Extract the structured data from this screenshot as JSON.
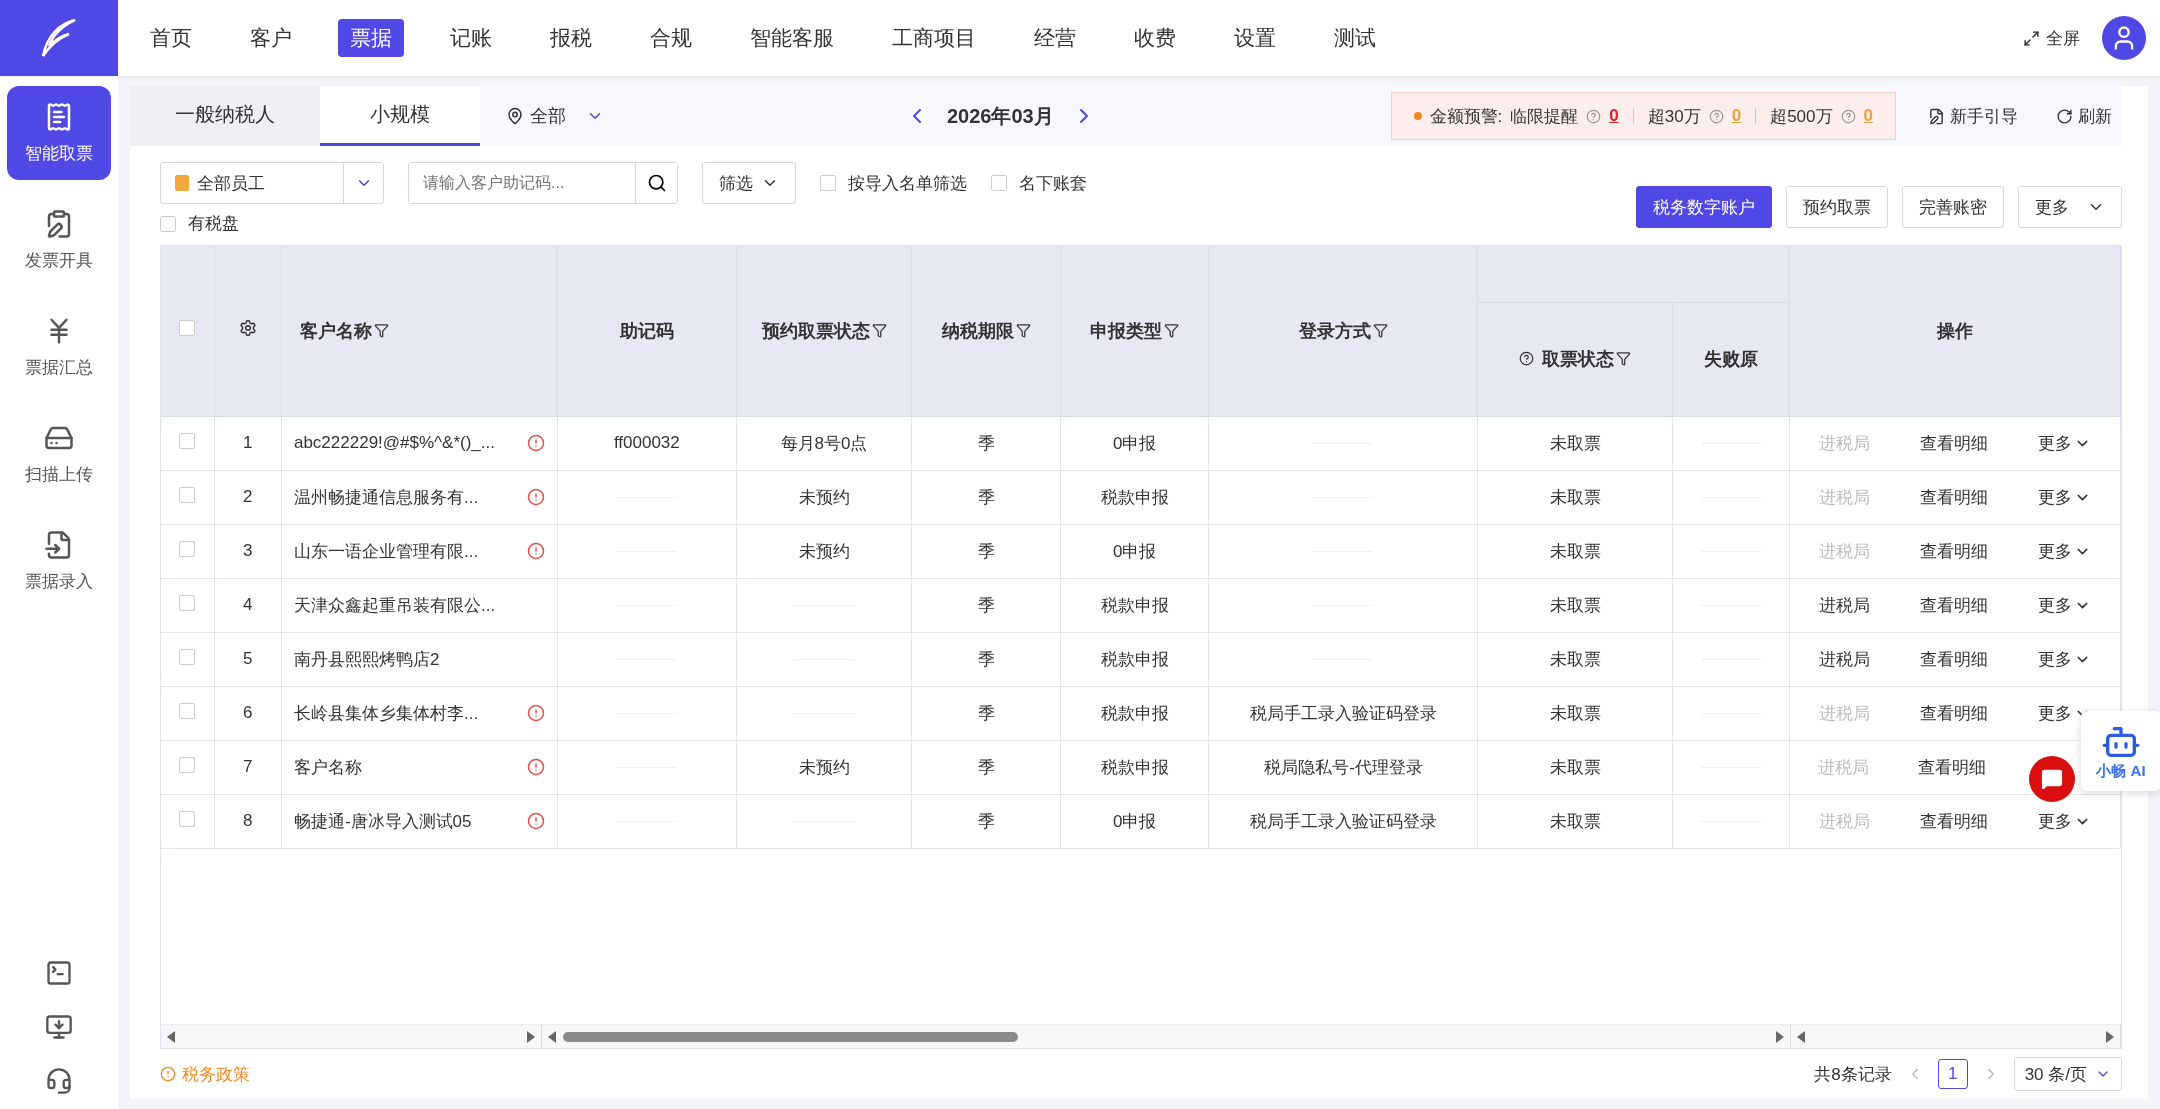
{
  "nav": {
    "items": [
      {
        "label": "首页",
        "selected": false
      },
      {
        "label": "客户",
        "selected": false
      },
      {
        "label": "票据",
        "selected": true
      },
      {
        "label": "记账",
        "selected": false
      },
      {
        "label": "报税",
        "selected": false
      },
      {
        "label": "合规",
        "selected": false
      },
      {
        "label": "智能客服",
        "selected": false
      },
      {
        "label": "工商项目",
        "selected": false
      },
      {
        "label": "经营",
        "selected": false
      },
      {
        "label": "收费",
        "selected": false
      },
      {
        "label": "设置",
        "selected": false
      },
      {
        "label": "测试",
        "selected": false
      }
    ],
    "fullscreen": "全屏"
  },
  "sidebar": {
    "items": [
      {
        "label": "智能取票",
        "selected": true
      },
      {
        "label": "发票开具",
        "selected": false
      },
      {
        "label": "票据汇总",
        "selected": false
      },
      {
        "label": "扫描上传",
        "selected": false
      },
      {
        "label": "票据录入",
        "selected": false
      }
    ]
  },
  "tabs": [
    {
      "label": "一般纳税人",
      "selected": false
    },
    {
      "label": "小规模",
      "selected": true
    }
  ],
  "location": "全部",
  "period": "2026年03月",
  "alert": {
    "title": "金额预警:",
    "items": [
      {
        "label": "临限提醒",
        "count": "0",
        "color": "#e02020"
      },
      {
        "label": "超30万",
        "count": "0",
        "color": "#e6a23c"
      },
      {
        "label": "超500万",
        "count": "0",
        "color": "#e6a23c"
      }
    ]
  },
  "header_actions": [
    "新手引导",
    "刷新"
  ],
  "toolbar": {
    "staff": "全部员工",
    "search": {
      "placeholder": "请输入客户助记码..."
    },
    "filter": "筛选",
    "checks": [
      {
        "label": "按导入名单筛选",
        "checked": false
      },
      {
        "label": "名下账套",
        "checked": false
      },
      {
        "label": "有税盘",
        "checked": false
      }
    ],
    "buttons": [
      {
        "label": "税务数字账户",
        "kind": "primary"
      },
      {
        "label": "预约取票",
        "kind": "plain"
      },
      {
        "label": "完善账密",
        "kind": "plain"
      },
      {
        "label": "更多",
        "kind": "dropdown"
      }
    ]
  },
  "table": {
    "select_all": {
      "checked": false
    },
    "columns": [
      {
        "label": "客户名称",
        "filter": true
      },
      {
        "label": "助记码",
        "filter": false
      },
      {
        "label": "预约取票状态",
        "filter": true
      },
      {
        "label": "纳税期限",
        "filter": true
      },
      {
        "label": "申报类型",
        "filter": true
      },
      {
        "label": "登录方式",
        "filter": true
      },
      {
        "label": "取票状态",
        "filter": true
      },
      {
        "label": "失败原",
        "filter": false
      },
      {
        "label": "操作",
        "filter": false
      }
    ],
    "rows": [
      {
        "checked": false,
        "index": "1",
        "name": "abc222229!@#$%^&*()_...",
        "warn": true,
        "code": "ff000032",
        "reserve": "每月8号0点",
        "period": "季",
        "type": "0申报",
        "login": null,
        "status": "未取票",
        "enter": {
          "label": "进税局",
          "disabled": true
        },
        "detail": "查看明细",
        "more": "更多"
      },
      {
        "checked": false,
        "index": "2",
        "name": "温州畅捷通信息服务有...",
        "warn": true,
        "code": null,
        "reserve": "未预约",
        "period": "季",
        "type": "税款申报",
        "login": null,
        "status": "未取票",
        "enter": {
          "label": "进税局",
          "disabled": true
        },
        "detail": "查看明细",
        "more": "更多"
      },
      {
        "checked": false,
        "index": "3",
        "name": "山东一语企业管理有限...",
        "warn": true,
        "code": null,
        "reserve": "未预约",
        "period": "季",
        "type": "0申报",
        "login": null,
        "status": "未取票",
        "enter": {
          "label": "进税局",
          "disabled": true
        },
        "detail": "查看明细",
        "more": "更多"
      },
      {
        "checked": false,
        "index": "4",
        "name": "天津众鑫起重吊装有限公...",
        "warn": false,
        "code": null,
        "reserve": null,
        "period": "季",
        "type": "税款申报",
        "login": null,
        "status": "未取票",
        "enter": {
          "label": "进税局",
          "disabled": false
        },
        "detail": "查看明细",
        "more": "更多"
      },
      {
        "checked": false,
        "index": "5",
        "name": "南丹县熙熙烤鸭店2",
        "warn": false,
        "code": null,
        "reserve": null,
        "period": "季",
        "type": "税款申报",
        "login": null,
        "status": "未取票",
        "enter": {
          "label": "进税局",
          "disabled": false
        },
        "detail": "查看明细",
        "more": "更多"
      },
      {
        "checked": false,
        "index": "6",
        "name": "长岭县集体乡集体村李...",
        "warn": true,
        "code": null,
        "reserve": null,
        "period": "季",
        "type": "税款申报",
        "login": "税局手工录入验证码登录",
        "status": "未取票",
        "enter": {
          "label": "进税局",
          "disabled": true
        },
        "detail": "查看明细",
        "more": "更多"
      },
      {
        "checked": false,
        "index": "7",
        "name": "客户名称",
        "warn": true,
        "code": null,
        "reserve": "未预约",
        "period": "季",
        "type": "税款申报",
        "login": "税局隐私号-代理登录",
        "status": "未取票",
        "enter": {
          "label": "进税局",
          "disabled": true
        },
        "detail": "查看明细",
        "more": null
      },
      {
        "checked": false,
        "index": "8",
        "name": "畅捷通-唐冰导入测试05",
        "warn": true,
        "code": null,
        "reserve": null,
        "period": "季",
        "type": "0申报",
        "login": "税局手工录入验证码登录",
        "status": "未取票",
        "enter": {
          "label": "进税局",
          "disabled": true
        },
        "detail": "查看明细",
        "more": "更多"
      }
    ]
  },
  "footer": {
    "policy": "税务政策",
    "total": "共8条记录",
    "pages": [
      {
        "label": "1",
        "selected": true
      }
    ],
    "page_size": "30 条/页"
  },
  "assistant": {
    "label": "小畅 AI"
  }
}
